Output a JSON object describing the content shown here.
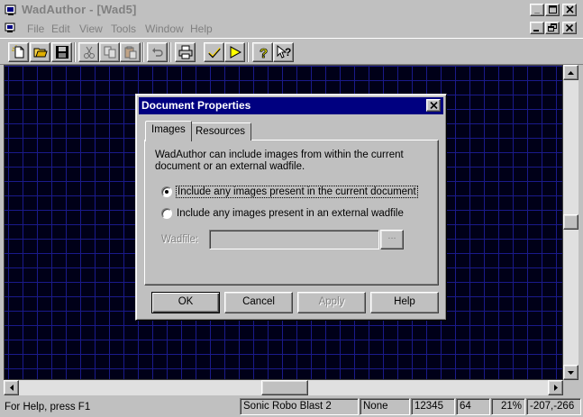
{
  "window": {
    "title": "WadAuthor - [Wad5]",
    "minimize_glyph": "_",
    "menu": [
      "File",
      "Edit",
      "View",
      "Tools",
      "Window",
      "Help"
    ]
  },
  "toolbar": {
    "buttons": [
      "new-file-icon",
      "open-folder-icon",
      "save-disk-icon",
      "cut-scissors-icon",
      "copy-icon",
      "paste-icon",
      "undo-icon",
      "print-icon",
      "check-icon",
      "run-play-icon",
      "help-question-icon",
      "context-help-icon"
    ]
  },
  "dialog": {
    "title": "Document Properties",
    "tabs": {
      "images": "Images",
      "resources": "Resources"
    },
    "description": "WadAuthor can include images from within the current document or an external wadfile.",
    "option_current": "Include any images present in the current document",
    "option_external": "Include any images present in an external wadfile",
    "selected_option": "current",
    "wadfile_label": "Wadfile:",
    "wadfile_value": "",
    "browse_label": "...",
    "buttons": {
      "ok": "OK",
      "cancel": "Cancel",
      "apply": "Apply",
      "help": "Help"
    }
  },
  "statusbar": {
    "help_text": "For Help, press F1",
    "game": "Sonic Robo Blast 2",
    "selection": "None",
    "number1": "12345",
    "number2": "64",
    "zoom": "21%",
    "coords": "-207,-266"
  },
  "colors": {
    "face": "#c0c0c0",
    "titlebar_active": "#000080",
    "workspace_bg": "#000018",
    "grid_line": "#1a1a8a"
  }
}
